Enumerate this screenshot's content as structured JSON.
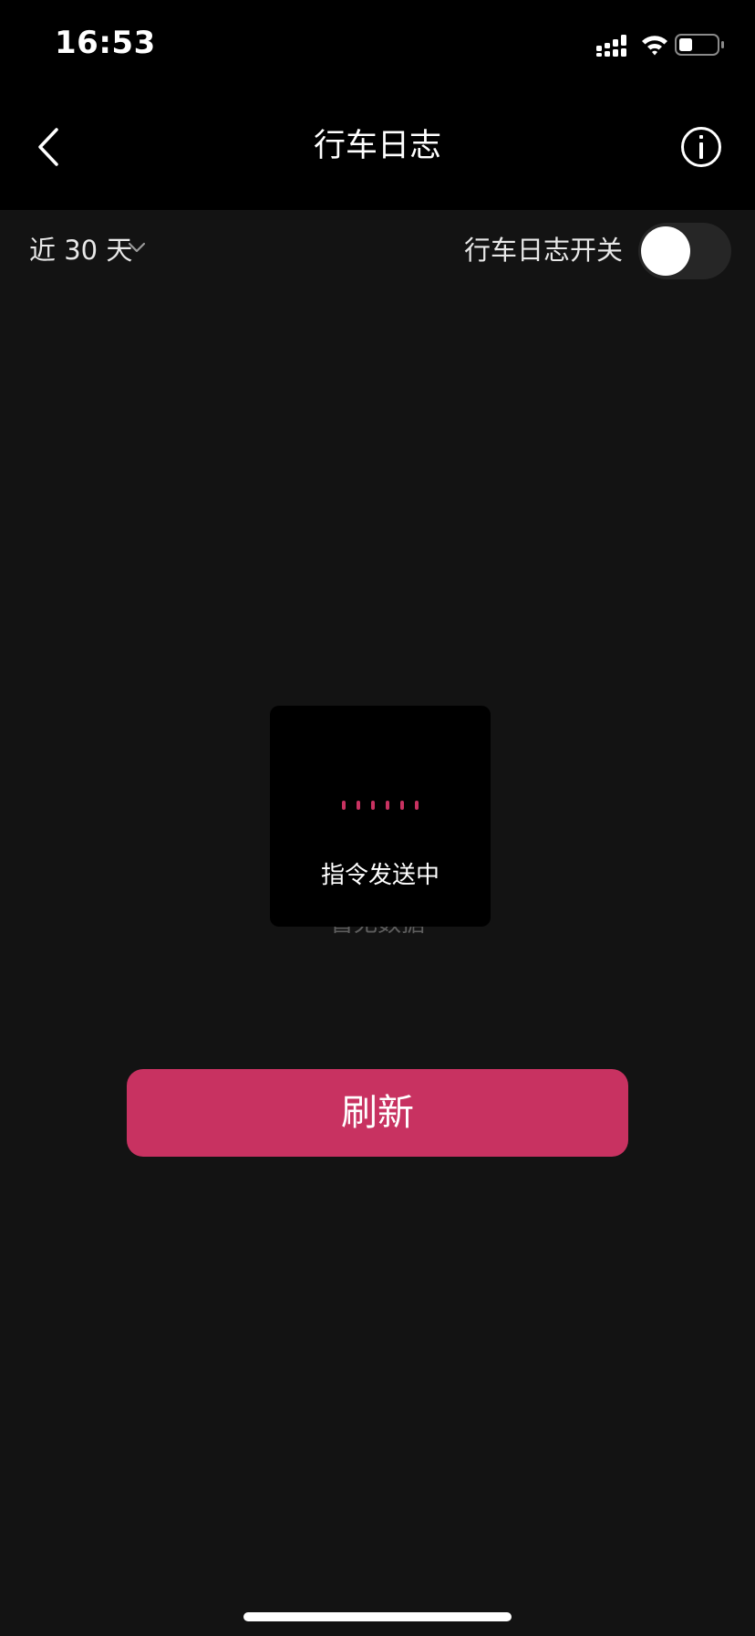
{
  "status_bar": {
    "time": "16:53",
    "icons": [
      "cellular-signal-icon",
      "wifi-icon",
      "battery-icon"
    ]
  },
  "nav": {
    "title": "行车日志",
    "back_icon": "chevron-left-icon",
    "info_icon": "info-circle-icon"
  },
  "filter": {
    "period_label": "近 30 天",
    "period_icon": "chevron-down-icon",
    "switch_label": "行车日志开关",
    "switch_on": false
  },
  "empty_state": {
    "text": "暂无数据"
  },
  "loading_toast": {
    "text": "指令发送中",
    "dot_count": 6
  },
  "refresh_button": {
    "label": "刷新"
  },
  "colors": {
    "background": "#131313",
    "header_background": "#000000",
    "accent": "#C83261",
    "toggle_track": "#262626",
    "muted_text": "#5D5D5D"
  }
}
